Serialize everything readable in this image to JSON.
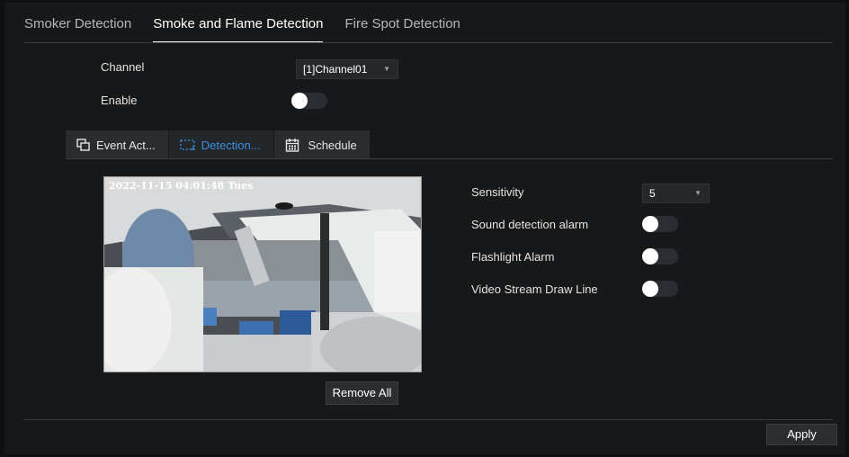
{
  "top_tabs": [
    {
      "label": "Smoker Detection"
    },
    {
      "label": "Smoke and Flame Detection"
    },
    {
      "label": "Fire Spot Detection"
    }
  ],
  "active_top_tab": "Smoke and Flame Detection",
  "channel": {
    "label": "Channel",
    "value": "[1]Channel01"
  },
  "enable": {
    "label": "Enable",
    "on": true
  },
  "sub_tabs": [
    {
      "label": "Event Act...",
      "icon": "event-action-icon"
    },
    {
      "label": "Detection...",
      "icon": "detection-area-icon"
    },
    {
      "label": "Schedule",
      "icon": "calendar-icon"
    }
  ],
  "active_sub_tab": "Detection...",
  "video": {
    "timestamp": "2022-11-15 04:01:48 Tues"
  },
  "settings": {
    "sensitivity": {
      "label": "Sensitivity",
      "value": "5"
    },
    "sound_alarm": {
      "label": "Sound detection alarm",
      "on": true
    },
    "flashlight_alarm": {
      "label": "Flashlight Alarm",
      "on": true
    },
    "draw_line": {
      "label": "Video Stream Draw Line",
      "on": true
    }
  },
  "buttons": {
    "remove_all": "Remove All",
    "apply": "Apply"
  },
  "colors": {
    "accent": "#3b8fe0",
    "background": "#161819",
    "toggle_track": "#2a2e33"
  }
}
